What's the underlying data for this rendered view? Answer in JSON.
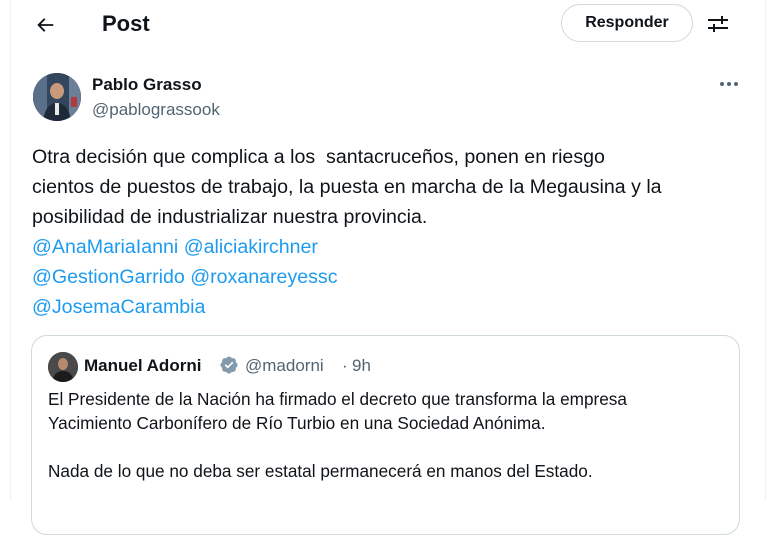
{
  "header": {
    "title": "Post",
    "reply_label": "Responder"
  },
  "author": {
    "name": "Pablo Grasso",
    "handle": "@pablograssook"
  },
  "tweet": {
    "text": "Otra decisión que complica a los  santacruceños, ponen en riesgo\ncientos de puestos de trabajo, la puesta en marcha de la Megausina y la\nposibilidad de industrializar nuestra provincia.",
    "mentions": [
      "@AnaMariaIanni",
      "@aliciakirchner",
      "@GestionGarrido",
      "@roxanareyessc",
      "@JosemaCarambia"
    ]
  },
  "quote": {
    "name": "Manuel Adorni",
    "handle": "@madorni",
    "separator": "·",
    "time": "9h",
    "line1": "El Presidente de la Nación ha firmado el decreto que transforma la empresa",
    "line2": "Yacimiento Carbonífero de Río Turbio en una Sociedad Anónima.",
    "line3": "Nada de lo que no deba ser estatal permanecerá en manos del Estado."
  },
  "colors": {
    "link": "#1d9bf0",
    "secondary_text": "#536471",
    "border": "#cfd9de"
  }
}
